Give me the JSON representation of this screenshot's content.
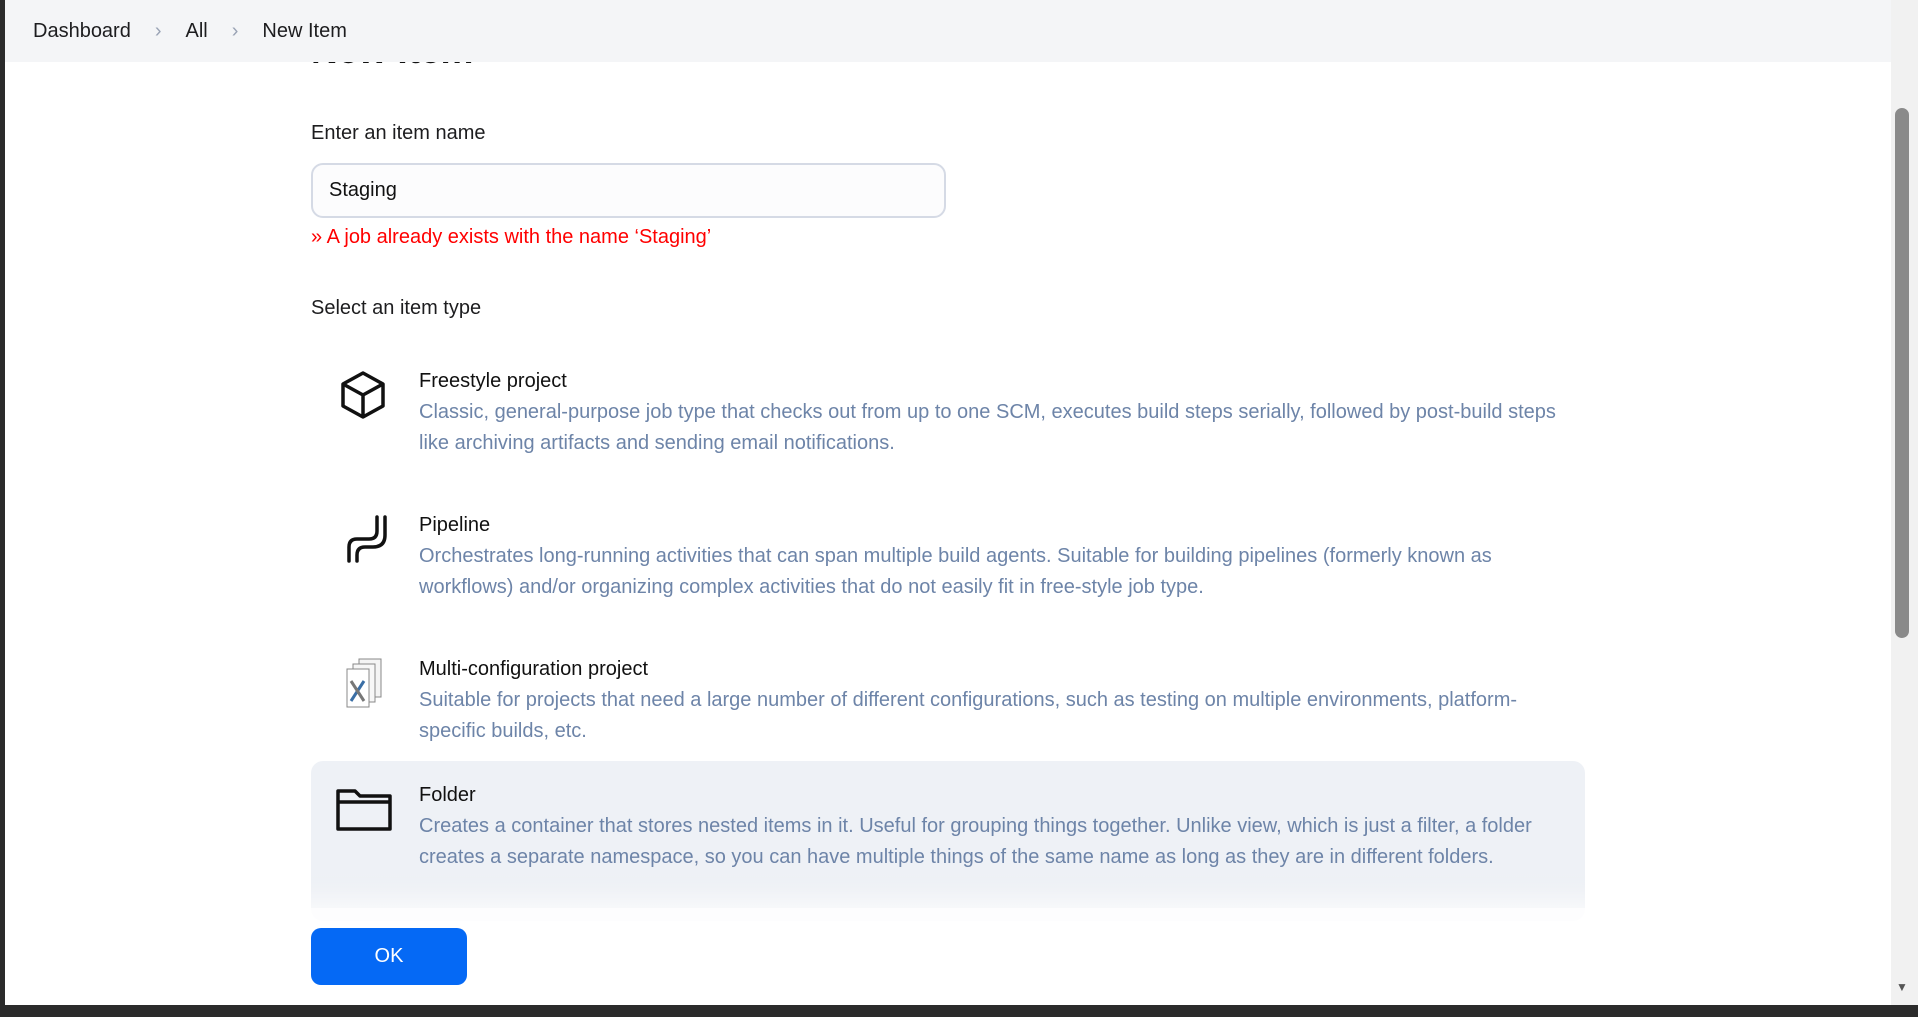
{
  "breadcrumb": [
    "Dashboard",
    "All",
    "New Item"
  ],
  "page_title": "New Item",
  "name_label": "Enter an item name",
  "name_value": "Staging",
  "error": "» A job already exists with the name ‘Staging’",
  "type_label": "Select an item type",
  "items": [
    {
      "title": "Freestyle project",
      "desc": "Classic, general-purpose job type that checks out from up to one SCM, executes build steps serially, followed by post-build steps like archiving artifacts and sending email notifications.",
      "icon": "cube-icon"
    },
    {
      "title": "Pipeline",
      "desc": "Orchestrates long-running activities that can span multiple build agents. Suitable for building pipelines (formerly known as workflows) and/or organizing complex activities that do not easily fit in free-style job type.",
      "icon": "pipeline-icon"
    },
    {
      "title": "Multi-configuration project",
      "desc": "Suitable for projects that need a large number of different configurations, such as testing on multiple environments, platform-specific builds, etc.",
      "icon": "multi-config-icon"
    },
    {
      "title": "Folder",
      "desc": "Creates a container that stores nested items in it. Useful for grouping things together. Unlike view, which is just a filter, a folder creates a separate namespace, so you can have multiple things of the same name as long as they are in different folders.",
      "icon": "folder-icon",
      "selected": true
    }
  ],
  "ok_label": "OK",
  "colors": {
    "accent": "#0569f5",
    "error": "#ff0000",
    "desc": "#6d84a8"
  }
}
